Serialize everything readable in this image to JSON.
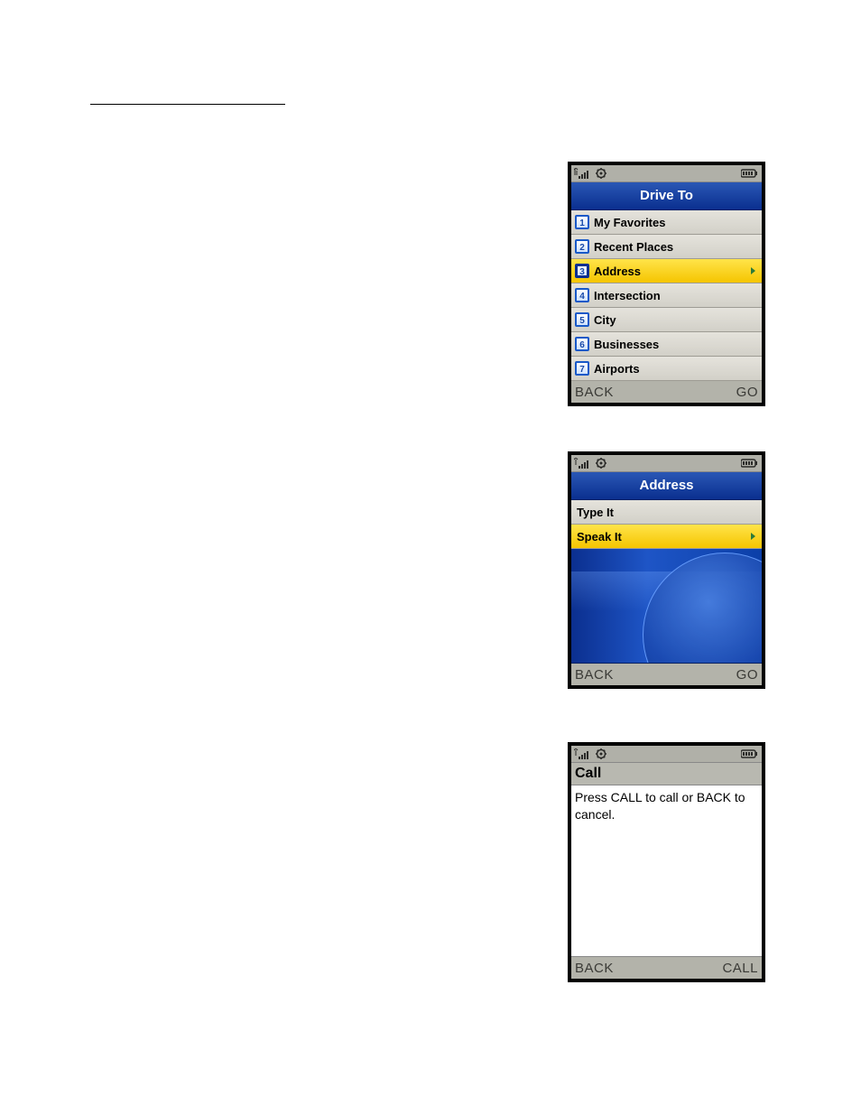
{
  "phone1": {
    "softkey_left": "BACK",
    "softkey_right": "GO",
    "title": "Drive To",
    "items": [
      {
        "num": "1",
        "label": "My Favorites",
        "selected": false
      },
      {
        "num": "2",
        "label": "Recent Places",
        "selected": false
      },
      {
        "num": "3",
        "label": "Address",
        "selected": true
      },
      {
        "num": "4",
        "label": "Intersection",
        "selected": false
      },
      {
        "num": "5",
        "label": "City",
        "selected": false
      },
      {
        "num": "6",
        "label": "Businesses",
        "selected": false
      },
      {
        "num": "7",
        "label": "Airports",
        "selected": false
      }
    ]
  },
  "phone2": {
    "softkey_left": "BACK",
    "softkey_right": "GO",
    "title": "Address",
    "items": [
      {
        "label": "Type It",
        "selected": false
      },
      {
        "label": "Speak It",
        "selected": true
      }
    ]
  },
  "phone3": {
    "softkey_left": "BACK",
    "softkey_right": "CALL",
    "title": "Call",
    "body": "Press CALL to call or BACK to cancel."
  }
}
